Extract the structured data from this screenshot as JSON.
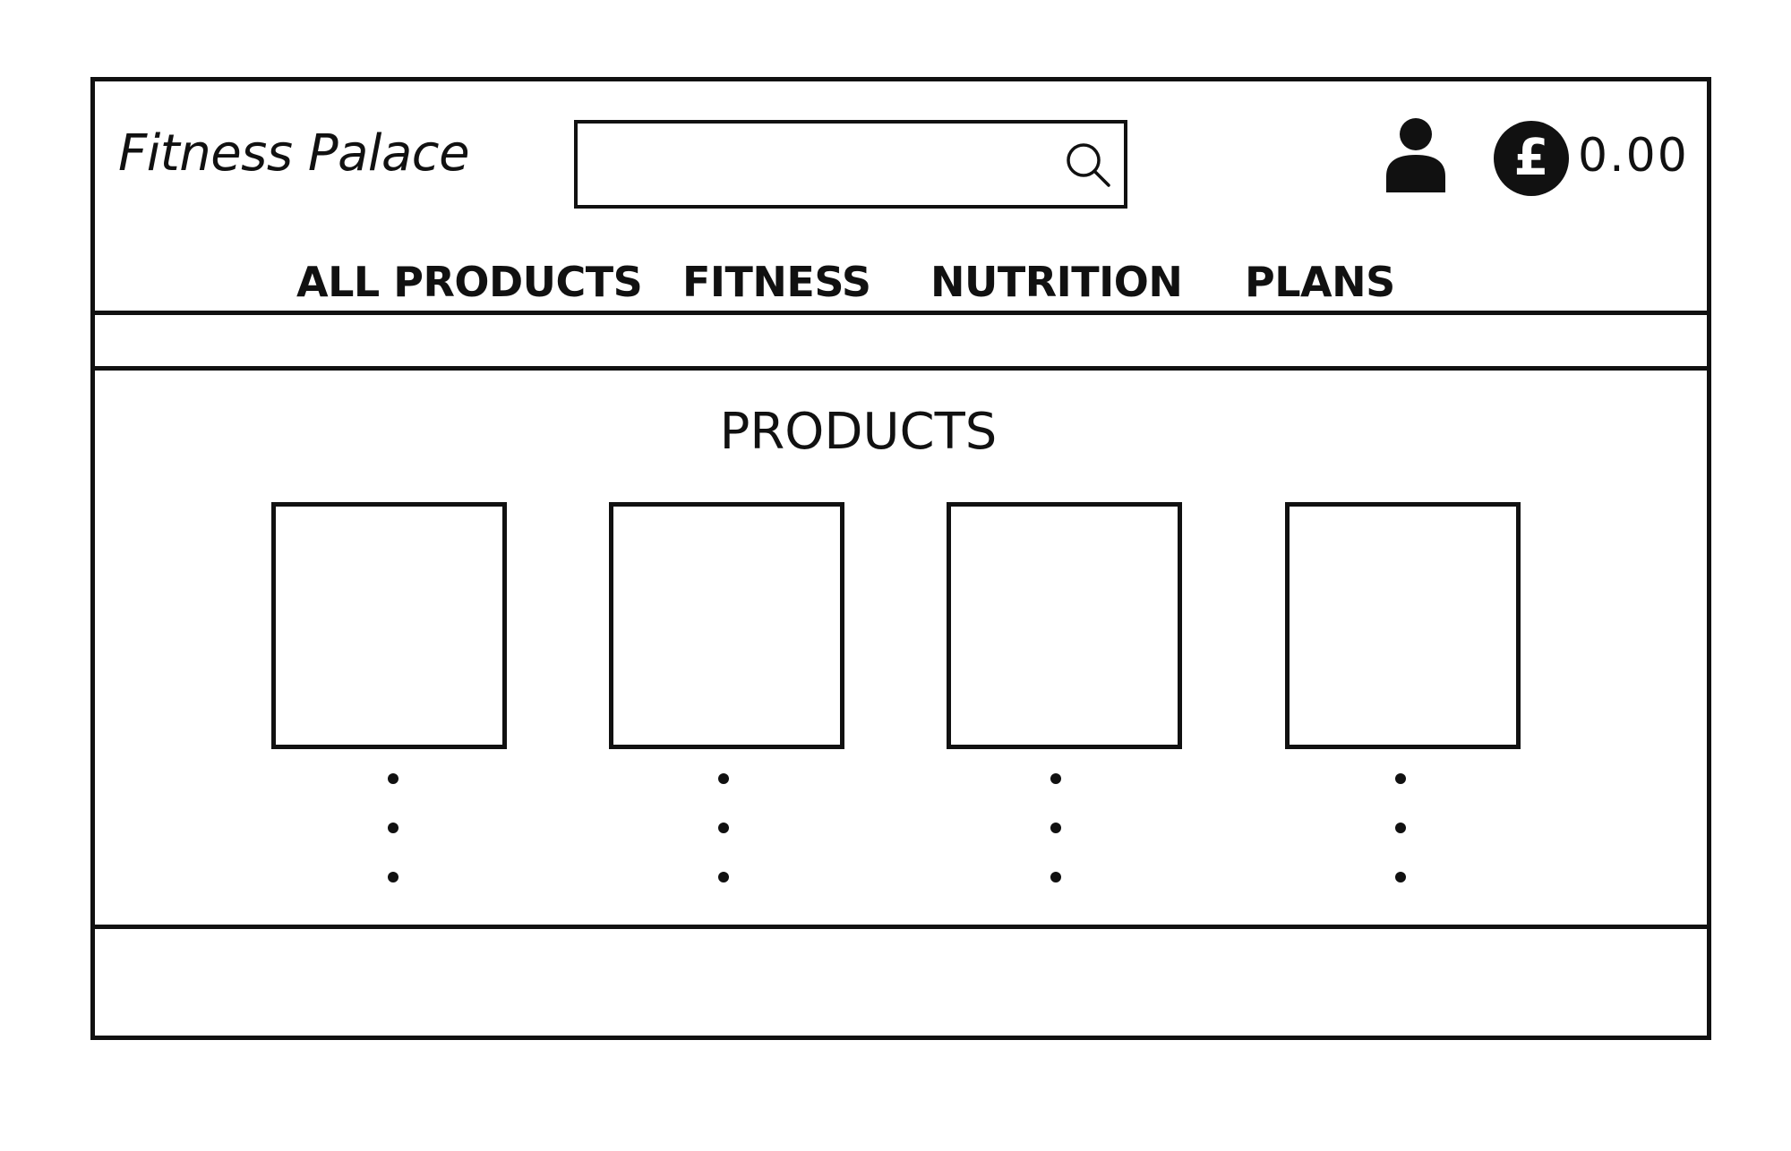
{
  "header": {
    "logo_text": "Fitness Palace",
    "search": {
      "value": "",
      "placeholder": "",
      "icon": "search-icon"
    },
    "account_icon": "user-icon",
    "cart": {
      "currency_icon": "pound-icon",
      "currency_symbol": "£",
      "total": "0.00"
    }
  },
  "nav": {
    "items": [
      {
        "label": "ALL PRODUCTS"
      },
      {
        "label": "FITNESS"
      },
      {
        "label": "NUTRITION"
      },
      {
        "label": "PLANS"
      }
    ]
  },
  "main": {
    "section_title": "PRODUCTS",
    "products": [
      {
        "placeholder": "product-image"
      },
      {
        "placeholder": "product-image"
      },
      {
        "placeholder": "product-image"
      },
      {
        "placeholder": "product-image"
      }
    ],
    "more_indicator": "vertical-ellipsis"
  },
  "colors": {
    "line": "#111111",
    "background": "#ffffff"
  }
}
